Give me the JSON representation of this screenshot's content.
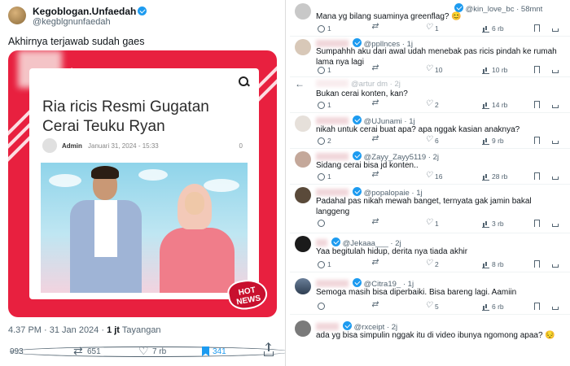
{
  "tweet": {
    "display_name": "Kegoblogan.Unfaedah",
    "handle": "@kegblgnunfaedah",
    "text": "Akhirnya terjawab sudah gaes",
    "article": {
      "headline": "Ria ricis Resmi Gugatan Cerai Teuku Ryan",
      "author": "Admin",
      "date": "Januari 31, 2024 - 15:33",
      "comment_count": "0",
      "badge": "HOT NEWS"
    },
    "time": "4.37 PM · 31 Jan 2024 ·",
    "views": "1 jt",
    "views_label": "Tayangan",
    "stats": {
      "replies": "993",
      "retweets": "651",
      "likes": "7 rb",
      "bookmarks": "341"
    },
    "colors": {
      "accent": "#1d9bf0",
      "media_bg": "#e8203f"
    }
  },
  "replies": [
    {
      "handle": "@kin_love_bc",
      "time": "58mnt",
      "text": "Mana yg bilang suaminya greenflag? 😊",
      "stats": {
        "replies": "1",
        "retweets": "",
        "likes": "1",
        "views": "6 rb"
      }
    },
    {
      "handle": "@ppllnces",
      "time": "1j",
      "text": "Sumpahhh aku dari awal udah menebak pas ricis pindah ke rumah lama nya lagi",
      "stats": {
        "replies": "1",
        "retweets": "",
        "likes": "10",
        "views": "10 rb"
      }
    },
    {
      "handle": "@artur dm",
      "time": "2j",
      "text": "Bukan cerai konten, kan?",
      "stats": {
        "replies": "1",
        "retweets": "",
        "likes": "2",
        "views": "14 rb"
      }
    },
    {
      "handle": "@UJunami",
      "time": "1j",
      "text": "nikah untuk cerai buat apa? apa nggak kasian anaknya?",
      "stats": {
        "replies": "2",
        "retweets": "",
        "likes": "6",
        "views": "9 rb"
      }
    },
    {
      "handle": "@Zayy_Zayy5119",
      "time": "2j",
      "text": "Sidang cerai bisa jd konten..",
      "stats": {
        "replies": "1",
        "retweets": "",
        "likes": "16",
        "views": "28 rb"
      }
    },
    {
      "handle": "@popalopaie",
      "time": "1j",
      "text": "Padahal pas nikah mewah banget, ternyata gak jamin bakal langgeng",
      "stats": {
        "replies": "",
        "retweets": "",
        "likes": "1",
        "views": "3 rb"
      }
    },
    {
      "handle": "@Jekaaa___",
      "time": "2j",
      "text": "Yaa begitulah hidup, derita nya tiada akhir",
      "stats": {
        "replies": "1",
        "retweets": "",
        "likes": "2",
        "views": "8 rb"
      }
    },
    {
      "handle": "@Citra19_",
      "time": "1j",
      "text": "Semoga masih bisa diperbaiki. Bisa bareng lagi. Aamiin",
      "stats": {
        "replies": "",
        "retweets": "",
        "likes": "5",
        "views": "6 rb"
      }
    },
    {
      "handle": "@rxceipt",
      "time": "2j",
      "text": "ada yg bisa simpulin nggak itu di video ibunya ngomong apaa? 😔",
      "stats": {
        "replies": "",
        "retweets": "",
        "likes": "",
        "views": ""
      }
    }
  ]
}
